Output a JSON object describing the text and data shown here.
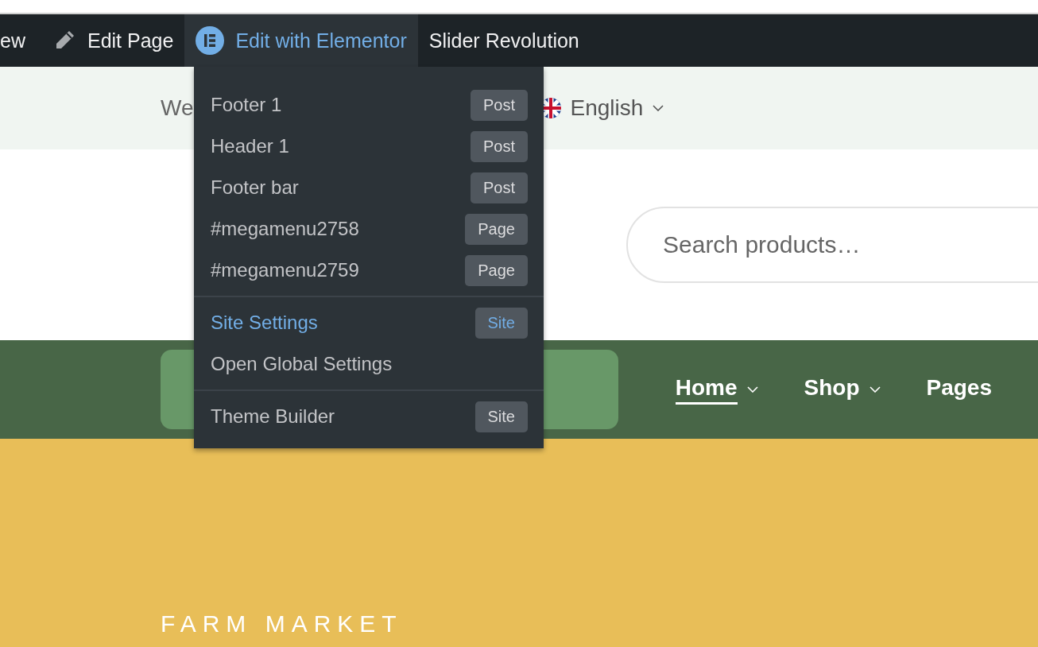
{
  "admin_bar": {
    "items": [
      {
        "kind": "text",
        "label": "ew",
        "selected": false
      },
      {
        "kind": "edit",
        "label": "Edit Page",
        "selected": false
      },
      {
        "kind": "elementor",
        "label": "Edit with Elementor",
        "selected": true
      },
      {
        "kind": "text",
        "label": "Slider Revolution",
        "selected": false
      }
    ]
  },
  "dropdown": {
    "groups": [
      {
        "items": [
          {
            "label": "Footer 1",
            "badge": "Post",
            "highlighted": false
          },
          {
            "label": "Header 1",
            "badge": "Post",
            "highlighted": false
          },
          {
            "label": "Footer bar",
            "badge": "Post",
            "highlighted": false
          },
          {
            "label": "#megamenu2758",
            "badge": "Page",
            "highlighted": false
          },
          {
            "label": "#megamenu2759",
            "badge": "Page",
            "highlighted": false
          }
        ]
      },
      {
        "items": [
          {
            "label": "Site Settings",
            "badge": "Site",
            "highlighted": true
          },
          {
            "label": "Open Global Settings",
            "highlighted": false
          }
        ]
      },
      {
        "items": [
          {
            "label": "Theme Builder",
            "badge": "Site",
            "highlighted": false
          }
        ]
      }
    ]
  },
  "topbar": {
    "welcome": "We",
    "language": "English"
  },
  "header": {
    "search": {
      "placeholder": "Search products…"
    }
  },
  "nav": {
    "items": [
      {
        "label": "Home",
        "selected": true,
        "has_submenu": true
      },
      {
        "label": "Shop",
        "selected": false,
        "has_submenu": true
      },
      {
        "label": "Pages",
        "selected": false,
        "has_submenu": false
      }
    ]
  },
  "hero": {
    "title": "FARM MARKET"
  }
}
